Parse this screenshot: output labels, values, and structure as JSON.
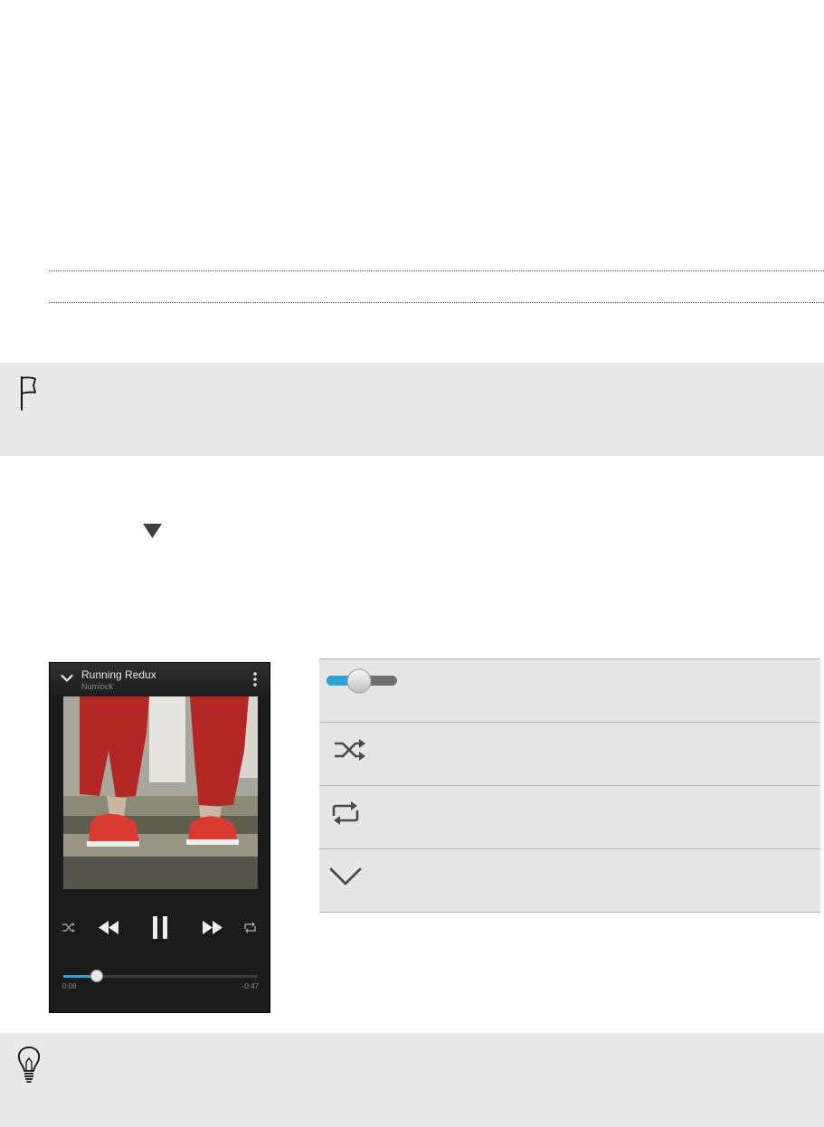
{
  "player": {
    "song_title": "Running Redux",
    "artist": "Numlock",
    "elapsed": "0:08",
    "remaining": "-0:47",
    "progress": 0.17,
    "accent_color": "#2ea3d6"
  },
  "icons": {
    "note": "flag-icon",
    "tip": "lightbulb-icon",
    "menu": "triangle-down-icon",
    "legend": [
      "toggle-switch-icon",
      "shuffle-icon",
      "repeat-icon",
      "chevron-down-icon"
    ]
  },
  "colors": {
    "note_background": "#e8e8e8",
    "legend_background": "#e6e6e6"
  }
}
